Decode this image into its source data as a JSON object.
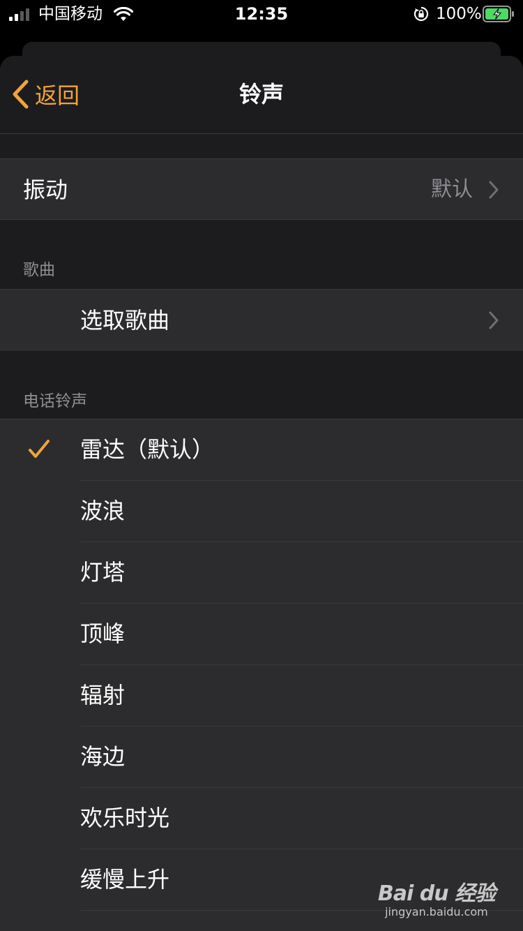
{
  "status_bar": {
    "carrier": "中国移动",
    "time": "12:35",
    "battery_percent": "100%",
    "signal_bars_active": 2,
    "signal_bars_total": 4,
    "battery_charging": true
  },
  "nav": {
    "back_label": "返回",
    "title": "铃声",
    "accent_color": "#f1a33b"
  },
  "vibration": {
    "label": "振动",
    "value": "默认"
  },
  "songs": {
    "header": "歌曲",
    "pick_label": "选取歌曲"
  },
  "ringtones": {
    "header": "电话铃声",
    "selected_index": 0,
    "items": [
      {
        "label": "雷达（默认）"
      },
      {
        "label": "波浪"
      },
      {
        "label": "灯塔"
      },
      {
        "label": "顶峰"
      },
      {
        "label": "辐射"
      },
      {
        "label": "海边"
      },
      {
        "label": "欢乐时光"
      },
      {
        "label": "缓慢上升"
      },
      {
        "label": ""
      }
    ]
  },
  "watermark": {
    "logo": "Bai du 经验",
    "url": "jingyan.baidu.com"
  },
  "colors": {
    "background": "#000000",
    "sheet": "#1c1c1e",
    "cell": "#2c2c2e",
    "separator": "#3a3a3c",
    "secondary_text": "#8e8e93"
  }
}
